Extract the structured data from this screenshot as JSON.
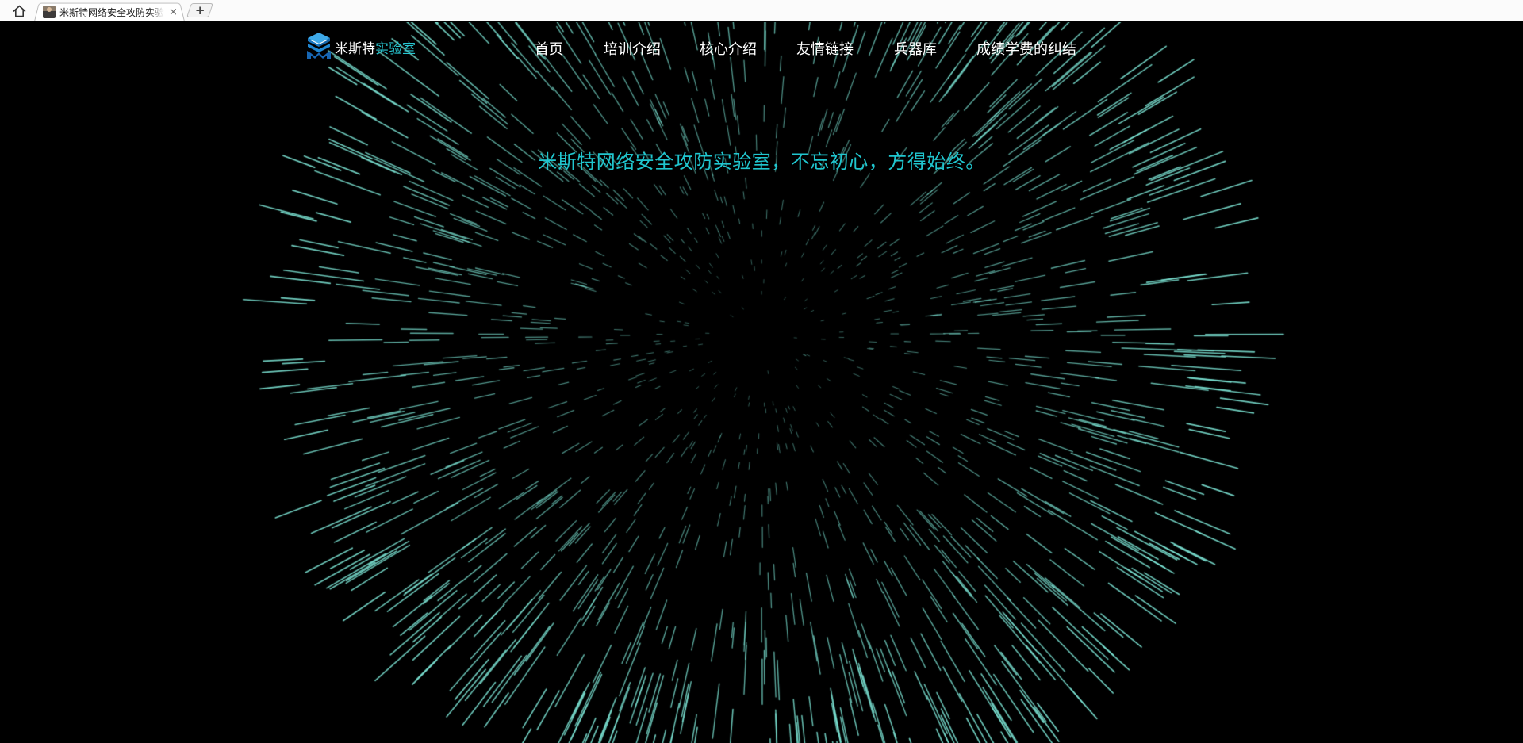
{
  "browser": {
    "tab_title": "米斯特网络安全攻防实验室",
    "close_glyph": "×",
    "new_tab_glyph": "+"
  },
  "header": {
    "logo_part1": "米斯特",
    "logo_part2": "实验室",
    "nav": [
      "首页",
      "培训介绍",
      "核心介绍",
      "友情链接",
      "兵器库",
      "成绩学费的纠结"
    ]
  },
  "hero": {
    "slogan": "米斯特网络安全攻防实验室，不忘初心，方得始终。"
  },
  "colors": {
    "background": "#000000",
    "accent": "#27c6d1",
    "star_line": "#7ee8d8",
    "nav_text": "#ffffff"
  },
  "icons": {
    "home": "home-icon",
    "logo": "cube-logo-icon",
    "favicon": "avatar-favicon"
  }
}
